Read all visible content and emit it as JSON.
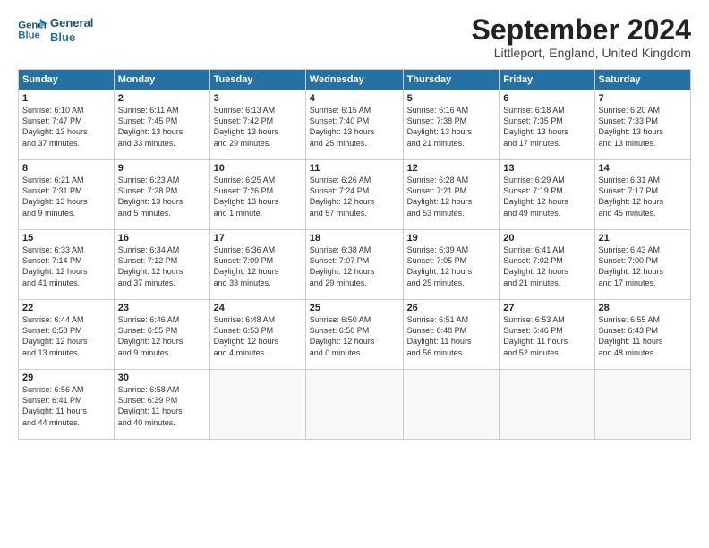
{
  "header": {
    "logo_line1": "General",
    "logo_line2": "Blue",
    "month_title": "September 2024",
    "location": "Littleport, England, United Kingdom"
  },
  "days_of_week": [
    "Sunday",
    "Monday",
    "Tuesday",
    "Wednesday",
    "Thursday",
    "Friday",
    "Saturday"
  ],
  "weeks": [
    [
      {
        "day": "1",
        "info": "Sunrise: 6:10 AM\nSunset: 7:47 PM\nDaylight: 13 hours\nand 37 minutes."
      },
      {
        "day": "2",
        "info": "Sunrise: 6:11 AM\nSunset: 7:45 PM\nDaylight: 13 hours\nand 33 minutes."
      },
      {
        "day": "3",
        "info": "Sunrise: 6:13 AM\nSunset: 7:42 PM\nDaylight: 13 hours\nand 29 minutes."
      },
      {
        "day": "4",
        "info": "Sunrise: 6:15 AM\nSunset: 7:40 PM\nDaylight: 13 hours\nand 25 minutes."
      },
      {
        "day": "5",
        "info": "Sunrise: 6:16 AM\nSunset: 7:38 PM\nDaylight: 13 hours\nand 21 minutes."
      },
      {
        "day": "6",
        "info": "Sunrise: 6:18 AM\nSunset: 7:35 PM\nDaylight: 13 hours\nand 17 minutes."
      },
      {
        "day": "7",
        "info": "Sunrise: 6:20 AM\nSunset: 7:33 PM\nDaylight: 13 hours\nand 13 minutes."
      }
    ],
    [
      {
        "day": "8",
        "info": "Sunrise: 6:21 AM\nSunset: 7:31 PM\nDaylight: 13 hours\nand 9 minutes."
      },
      {
        "day": "9",
        "info": "Sunrise: 6:23 AM\nSunset: 7:28 PM\nDaylight: 13 hours\nand 5 minutes."
      },
      {
        "day": "10",
        "info": "Sunrise: 6:25 AM\nSunset: 7:26 PM\nDaylight: 13 hours\nand 1 minute."
      },
      {
        "day": "11",
        "info": "Sunrise: 6:26 AM\nSunset: 7:24 PM\nDaylight: 12 hours\nand 57 minutes."
      },
      {
        "day": "12",
        "info": "Sunrise: 6:28 AM\nSunset: 7:21 PM\nDaylight: 12 hours\nand 53 minutes."
      },
      {
        "day": "13",
        "info": "Sunrise: 6:29 AM\nSunset: 7:19 PM\nDaylight: 12 hours\nand 49 minutes."
      },
      {
        "day": "14",
        "info": "Sunrise: 6:31 AM\nSunset: 7:17 PM\nDaylight: 12 hours\nand 45 minutes."
      }
    ],
    [
      {
        "day": "15",
        "info": "Sunrise: 6:33 AM\nSunset: 7:14 PM\nDaylight: 12 hours\nand 41 minutes."
      },
      {
        "day": "16",
        "info": "Sunrise: 6:34 AM\nSunset: 7:12 PM\nDaylight: 12 hours\nand 37 minutes."
      },
      {
        "day": "17",
        "info": "Sunrise: 6:36 AM\nSunset: 7:09 PM\nDaylight: 12 hours\nand 33 minutes."
      },
      {
        "day": "18",
        "info": "Sunrise: 6:38 AM\nSunset: 7:07 PM\nDaylight: 12 hours\nand 29 minutes."
      },
      {
        "day": "19",
        "info": "Sunrise: 6:39 AM\nSunset: 7:05 PM\nDaylight: 12 hours\nand 25 minutes."
      },
      {
        "day": "20",
        "info": "Sunrise: 6:41 AM\nSunset: 7:02 PM\nDaylight: 12 hours\nand 21 minutes."
      },
      {
        "day": "21",
        "info": "Sunrise: 6:43 AM\nSunset: 7:00 PM\nDaylight: 12 hours\nand 17 minutes."
      }
    ],
    [
      {
        "day": "22",
        "info": "Sunrise: 6:44 AM\nSunset: 6:58 PM\nDaylight: 12 hours\nand 13 minutes."
      },
      {
        "day": "23",
        "info": "Sunrise: 6:46 AM\nSunset: 6:55 PM\nDaylight: 12 hours\nand 9 minutes."
      },
      {
        "day": "24",
        "info": "Sunrise: 6:48 AM\nSunset: 6:53 PM\nDaylight: 12 hours\nand 4 minutes."
      },
      {
        "day": "25",
        "info": "Sunrise: 6:50 AM\nSunset: 6:50 PM\nDaylight: 12 hours\nand 0 minutes."
      },
      {
        "day": "26",
        "info": "Sunrise: 6:51 AM\nSunset: 6:48 PM\nDaylight: 11 hours\nand 56 minutes."
      },
      {
        "day": "27",
        "info": "Sunrise: 6:53 AM\nSunset: 6:46 PM\nDaylight: 11 hours\nand 52 minutes."
      },
      {
        "day": "28",
        "info": "Sunrise: 6:55 AM\nSunset: 6:43 PM\nDaylight: 11 hours\nand 48 minutes."
      }
    ],
    [
      {
        "day": "29",
        "info": "Sunrise: 6:56 AM\nSunset: 6:41 PM\nDaylight: 11 hours\nand 44 minutes."
      },
      {
        "day": "30",
        "info": "Sunrise: 6:58 AM\nSunset: 6:39 PM\nDaylight: 11 hours\nand 40 minutes."
      },
      {
        "day": "",
        "info": ""
      },
      {
        "day": "",
        "info": ""
      },
      {
        "day": "",
        "info": ""
      },
      {
        "day": "",
        "info": ""
      },
      {
        "day": "",
        "info": ""
      }
    ]
  ]
}
